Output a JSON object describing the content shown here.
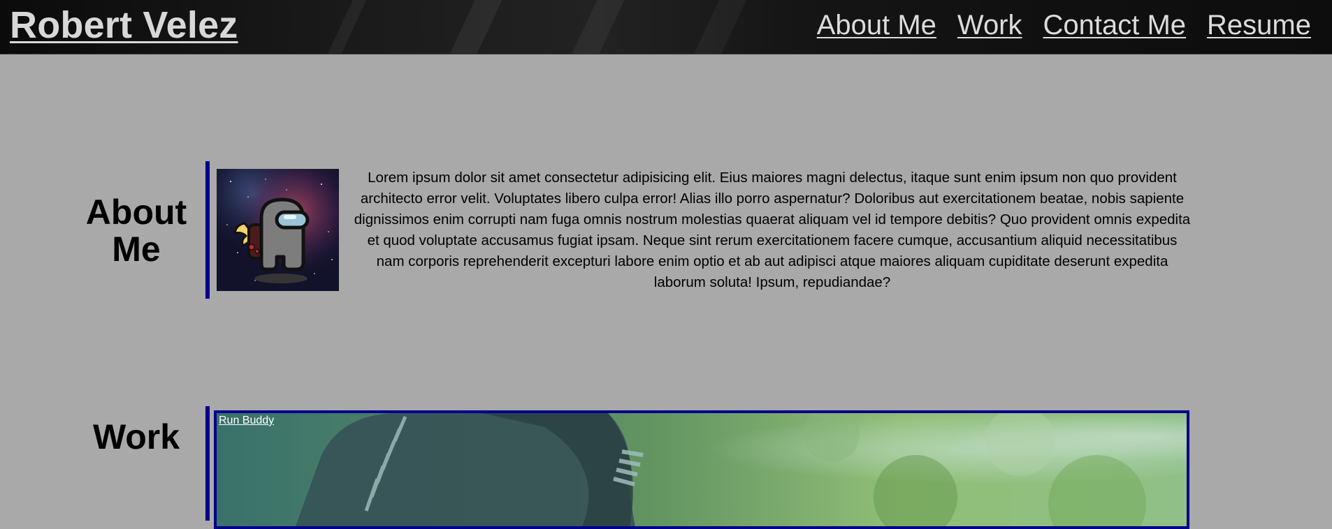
{
  "header": {
    "brand": "Robert Velez",
    "nav": [
      {
        "label": "About Me"
      },
      {
        "label": "Work"
      },
      {
        "label": "Contact Me"
      },
      {
        "label": "Resume"
      }
    ]
  },
  "about": {
    "title": "About Me",
    "text": "Lorem ipsum dolor sit amet consectetur adipisicing elit. Eius maiores magni delectus, itaque sunt enim ipsum non quo provident architecto error velit. Voluptates libero culpa error! Alias illo porro aspernatur? Doloribus aut exercitationem beatae, nobis sapiente dignissimos enim corrupti nam fuga omnis nostrum molestias quaerat aliquam vel id tempore debitis? Quo provident omnis expedita et quod voluptate accusamus fugiat ipsam. Neque sint rerum exercitationem facere cumque, accusantium aliquid necessitatibus nam corporis reprehenderit excepturi labore enim optio et ab aut adipisci atque maiores aliquam cupiditate deserunt expedita laborum soluta! Ipsum, repudiandae?",
    "avatar_icon": "among-us-crewmate-icon"
  },
  "work": {
    "title": "Work",
    "projects": [
      {
        "name": "Run Buddy"
      }
    ]
  },
  "colors": {
    "page_bg": "#a9a9a9",
    "accent": "#00008b",
    "header_bg": "#111111",
    "header_text": "#d8d8d8"
  }
}
